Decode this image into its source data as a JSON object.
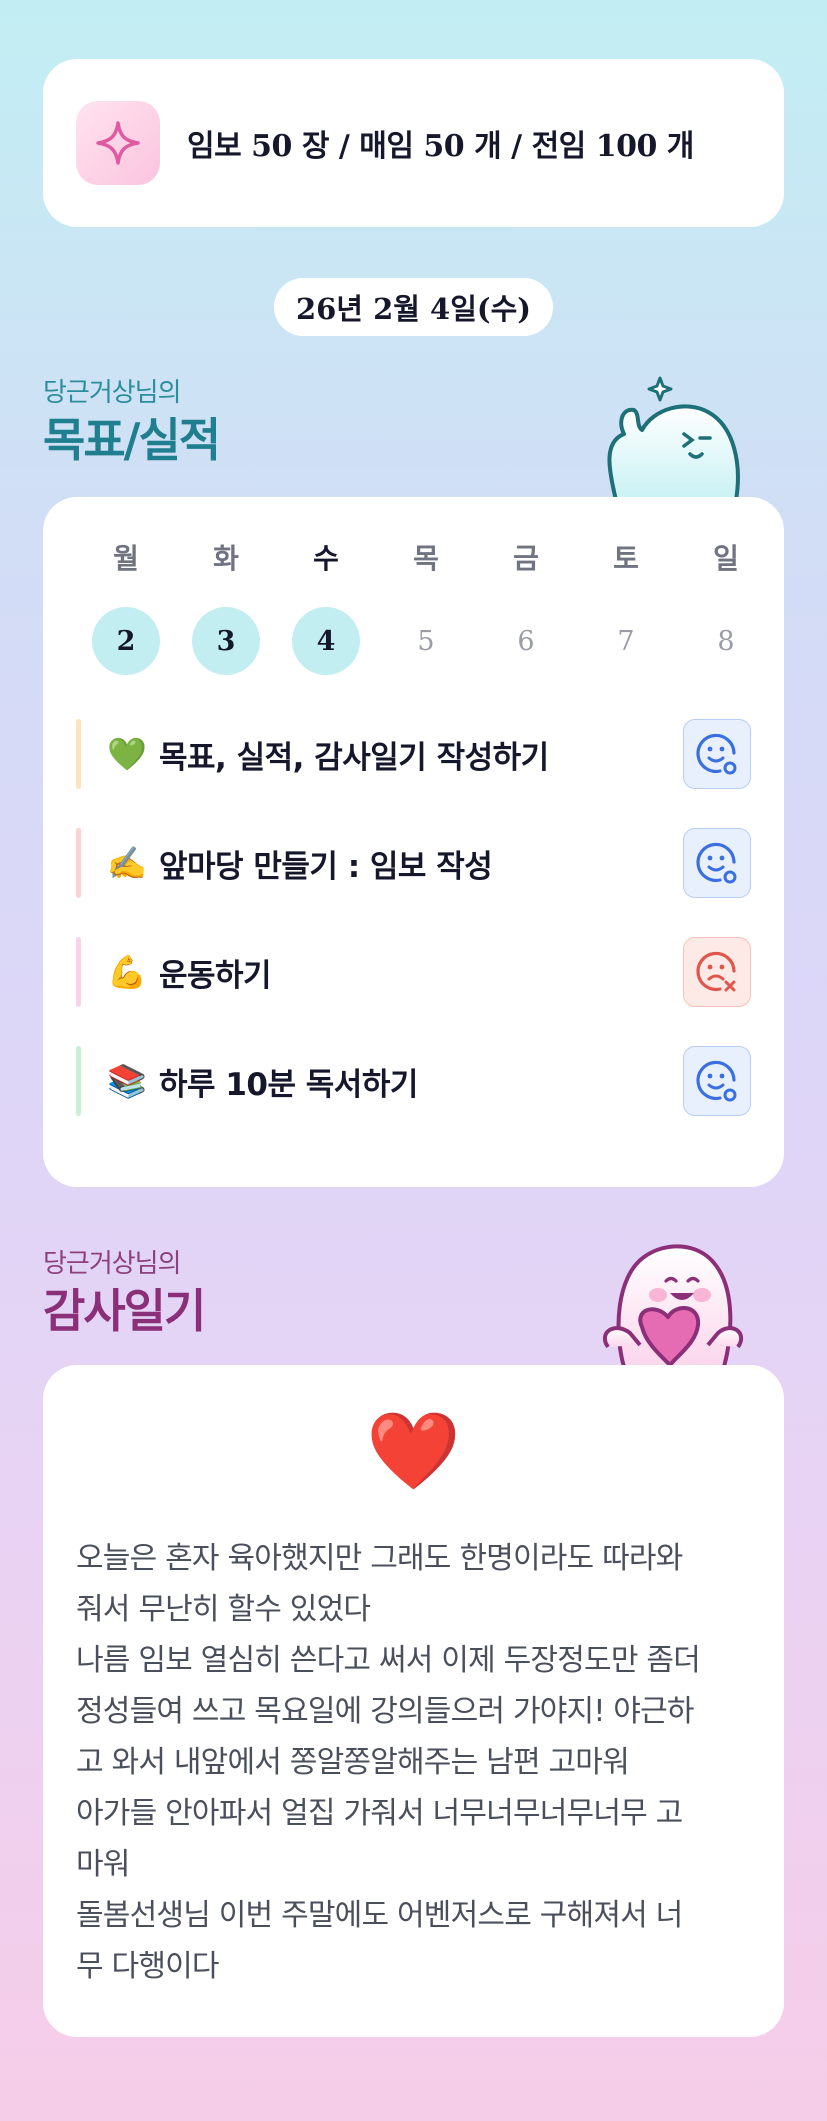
{
  "banner": {
    "icon": "sparkle-icon",
    "text": "임보 50 장 / 매임 50 개 / 전임 100 개"
  },
  "date": "26년 2월 4일(수)",
  "goals_section": {
    "subtitle": "당근거상님의",
    "title": "목표/실적"
  },
  "week": {
    "weekdays": [
      "월",
      "화",
      "수",
      "목",
      "금",
      "토",
      "일"
    ],
    "days": [
      "2",
      "3",
      "4",
      "5",
      "6",
      "7",
      "8"
    ],
    "completed_days": 3,
    "today_index": 2
  },
  "tasks": [
    {
      "emoji": "💚",
      "label": "목표, 실적, 감사일기 작성하기",
      "status": "done",
      "bar_color": "#fde3c0"
    },
    {
      "emoji": "✍️",
      "label": "앞마당 만들기 : 임보 작성",
      "status": "done",
      "bar_color": "#fcd3d3"
    },
    {
      "emoji": "💪",
      "label": "운동하기",
      "status": "failed",
      "bar_color": "#fbd2ea"
    },
    {
      "emoji": "📚",
      "label": "하루 10분 독서하기",
      "status": "done",
      "bar_color": "#c9f0d6"
    }
  ],
  "status_icons": {
    "done": "smile-check-icon",
    "failed": "sad-x-icon"
  },
  "gratitude_section": {
    "subtitle": "당근거상님의",
    "title": "감사일기"
  },
  "gratitude": {
    "emoji": "❤️",
    "text": "오늘은 혼자 육아했지만 그래도 한명이라도 따라와\n줘서 무난히 할수 있었다\n나름 임보 열심히 쓴다고 써서 이제 두장정도만 좀더\n정성들여 쓰고 목요일에 강의들으러 가야지! 야근하\n고 와서 내앞에서 쫑알쫑알해주는 남편 고마워\n아가들 안아파서 얼집 가줘서 너무너무너무너무 고\n마워\n돌봄선생님 이번 주말에도 어벤저스로 구해져서 너\n무 다행이다"
  },
  "colors": {
    "teal": "#1f7f8e",
    "magenta": "#8a2f78",
    "done_day": "#c3eef1",
    "ok_icon": "#3a6fe0",
    "fail_icon": "#e0564a"
  }
}
